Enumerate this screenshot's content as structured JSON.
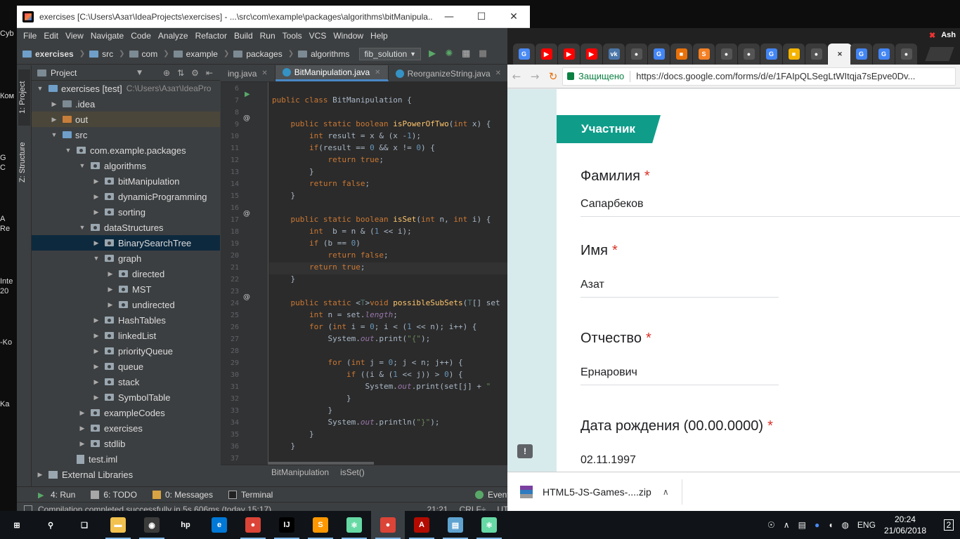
{
  "desktop": {
    "labels": [
      "Cyb",
      "Ком",
      "G",
      "C",
      "A",
      "Re",
      "Inte",
      "20",
      "-Ko",
      "Ka"
    ]
  },
  "idea": {
    "title": "exercises [C:\\Users\\Азат\\IdeaProjects\\exercises] - ...\\src\\com\\example\\packages\\algorithms\\bitManipula...",
    "menu": [
      "File",
      "Edit",
      "View",
      "Navigate",
      "Code",
      "Analyze",
      "Refactor",
      "Build",
      "Run",
      "Tools",
      "VCS",
      "Window",
      "Help"
    ],
    "nav": [
      "exercises",
      "src",
      "com",
      "example",
      "packages",
      "algorithms"
    ],
    "run_config": "fib_solution",
    "tool_strip": [
      "1: Project",
      "Z: Structure"
    ],
    "project_panel": {
      "title": "Project",
      "tree": [
        {
          "label": "exercises [test]",
          "path": "C:\\Users\\Азат\\IdeaPro",
          "depth": 0,
          "arrow": "down",
          "icon": "folder-blue"
        },
        {
          "label": ".idea",
          "depth": 1,
          "arrow": "right",
          "icon": "folder"
        },
        {
          "label": "out",
          "depth": 1,
          "arrow": "right",
          "icon": "folder-orange"
        },
        {
          "label": "src",
          "depth": 1,
          "arrow": "down",
          "icon": "folder-blue"
        },
        {
          "label": "com.example.packages",
          "depth": 2,
          "arrow": "down",
          "icon": "package"
        },
        {
          "label": "algorithms",
          "depth": 3,
          "arrow": "down",
          "icon": "package"
        },
        {
          "label": "bitManipulation",
          "depth": 4,
          "arrow": "right",
          "icon": "package"
        },
        {
          "label": "dynamicProgramming",
          "depth": 4,
          "arrow": "right",
          "icon": "package"
        },
        {
          "label": "sorting",
          "depth": 4,
          "arrow": "right",
          "icon": "package"
        },
        {
          "label": "dataStructures",
          "depth": 3,
          "arrow": "down",
          "icon": "package"
        },
        {
          "label": "BinarySearchTree",
          "depth": 4,
          "arrow": "right",
          "icon": "package"
        },
        {
          "label": "graph",
          "depth": 4,
          "arrow": "down",
          "icon": "package"
        },
        {
          "label": "directed",
          "depth": 5,
          "arrow": "right",
          "icon": "package"
        },
        {
          "label": "MST",
          "depth": 5,
          "arrow": "right",
          "icon": "package"
        },
        {
          "label": "undirected",
          "depth": 5,
          "arrow": "right",
          "icon": "package"
        },
        {
          "label": "HashTables",
          "depth": 4,
          "arrow": "right",
          "icon": "package"
        },
        {
          "label": "linkedList",
          "depth": 4,
          "arrow": "right",
          "icon": "package"
        },
        {
          "label": "priorityQueue",
          "depth": 4,
          "arrow": "right",
          "icon": "package"
        },
        {
          "label": "queue",
          "depth": 4,
          "arrow": "right",
          "icon": "package"
        },
        {
          "label": "stack",
          "depth": 4,
          "arrow": "right",
          "icon": "package"
        },
        {
          "label": "SymbolTable",
          "depth": 4,
          "arrow": "right",
          "icon": "package"
        },
        {
          "label": "exampleCodes",
          "depth": 3,
          "arrow": "right",
          "icon": "package"
        },
        {
          "label": "exercises",
          "depth": 3,
          "arrow": "right",
          "icon": "package"
        },
        {
          "label": "stdlib",
          "depth": 3,
          "arrow": "right",
          "icon": "package"
        },
        {
          "label": "test.iml",
          "depth": 2,
          "arrow": "",
          "icon": "file"
        },
        {
          "label": "External Libraries",
          "depth": 0,
          "arrow": "right",
          "icon": "library"
        }
      ]
    },
    "editor": {
      "tabs": [
        {
          "label": "ing.java",
          "active": false
        },
        {
          "label": "BitManipulation.java",
          "active": true
        },
        {
          "label": "ReorganizeString.java",
          "active": false
        }
      ],
      "line_numbers": [
        "6",
        "7",
        "8",
        "9",
        "10",
        "11",
        "12",
        "13",
        "14",
        "15",
        "16",
        "17",
        "18",
        "19",
        "20",
        "21",
        "22",
        "23",
        "24",
        "25",
        "26",
        "27",
        "28",
        "29",
        "30",
        "31",
        "32",
        "33",
        "34",
        "35",
        "36",
        "37"
      ],
      "lines": [
        "",
        "public class BitManipulation {",
        "",
        "    public static boolean isPowerOfTwo(int x) {",
        "        int result = x & (x -1);",
        "        if(result == 0 && x != 0) {",
        "            return true;",
        "        }",
        "        return false;",
        "    }",
        "",
        "    public static boolean isSet(int n, int i) {",
        "        int  b = n & (1 << i);",
        "        if (b == 0)",
        "            return false;",
        "        return true;",
        "    }",
        "",
        "    public static <T>void possibleSubSets(T[] set",
        "        int n = set.length;",
        "        for (int i = 0; i < (1 << n); i++) {",
        "            System.out.print(\"{\");",
        "",
        "            for (int j = 0; j < n; j++) {",
        "                if ((i & (1 << j)) > 0) {",
        "                    System.out.print(set[j] + \"",
        "                }",
        "            }",
        "            System.out.println(\"}\");",
        "        }",
        "    }",
        ""
      ],
      "breadcrumbs": [
        "BitManipulation",
        "isSet()"
      ]
    },
    "bottom_tools": [
      "4: Run",
      "6: TODO",
      "0: Messages",
      "Terminal",
      "Event Log"
    ],
    "status": {
      "message": "Compilation completed successfully in 5s 606ms (today 15:17)",
      "position": "21:21",
      "line_sep": "CRLF÷",
      "encoding": "UTF-8÷"
    }
  },
  "chrome": {
    "top_right": [
      "✖",
      "Ash"
    ],
    "tabs": [
      {
        "icon": "google-translate",
        "color": "#4a8af4",
        "label": "G"
      },
      {
        "icon": "youtube",
        "color": "#ff0000",
        "label": "▶"
      },
      {
        "icon": "youtube",
        "color": "#ff0000",
        "label": "▶"
      },
      {
        "icon": "youtube",
        "color": "#ff0000",
        "label": "▶"
      },
      {
        "icon": "vk",
        "color": "#4a76a8",
        "label": "vk"
      },
      {
        "icon": "github",
        "color": "#555555",
        "label": "●"
      },
      {
        "icon": "google",
        "color": "#4285f4",
        "label": "G"
      },
      {
        "icon": "document",
        "color": "#e8710a",
        "label": "■"
      },
      {
        "icon": "stackoverflow",
        "color": "#f48024",
        "label": "S"
      },
      {
        "icon": "github",
        "color": "#555555",
        "label": "●"
      },
      {
        "icon": "github",
        "color": "#555555",
        "label": "●"
      },
      {
        "icon": "google",
        "color": "#4285f4",
        "label": "G"
      },
      {
        "icon": "colors",
        "color": "#f4b400",
        "label": "■"
      },
      {
        "icon": "github",
        "color": "#555555",
        "label": "●"
      },
      {
        "icon": "close",
        "color": "#f2f2f2",
        "label": "✕",
        "active": true
      },
      {
        "icon": "google",
        "color": "#4285f4",
        "label": "G"
      },
      {
        "icon": "google",
        "color": "#4285f4",
        "label": "G"
      },
      {
        "icon": "github",
        "color": "#555555",
        "label": "●"
      }
    ],
    "secure_label": "Защищено",
    "url": "https://docs.google.com/forms/d/e/1FAIpQLSegLtWItqja7sEpve0Dv...",
    "form": {
      "section_title": "Участник",
      "questions": [
        {
          "label": "Фамилия",
          "required": "*",
          "answer": "Сапарбеков"
        },
        {
          "label": "Имя",
          "required": "*",
          "answer": "Азат"
        },
        {
          "label": "Отчество",
          "required": "*",
          "answer": "Ернарович"
        },
        {
          "label": "Дата рождения (00.00.0000)",
          "required": "*",
          "answer": "02.11.1997"
        }
      ],
      "feedback_glyph": "!"
    },
    "download": {
      "filename": "HTML5-JS-Games-....zip",
      "chevron": "∧"
    }
  },
  "taskbar": {
    "apps": [
      {
        "name": "start",
        "label": "⊞",
        "color": "#101418"
      },
      {
        "name": "search",
        "label": "⚲",
        "color": "#101418"
      },
      {
        "name": "task-view",
        "label": "❑",
        "color": "#101418"
      },
      {
        "name": "file-explorer",
        "label": "▬",
        "color": "#f2c14e"
      },
      {
        "name": "media",
        "label": "◉",
        "color": "#3b3b3b"
      },
      {
        "name": "hp",
        "label": "hp",
        "color": "#101418"
      },
      {
        "name": "edge",
        "label": "e",
        "color": "#0078d7"
      },
      {
        "name": "chrome",
        "label": "●",
        "color": "#db4437"
      },
      {
        "name": "intellij",
        "label": "IJ",
        "color": "#000000"
      },
      {
        "name": "sublime",
        "label": "S",
        "color": "#ff9800"
      },
      {
        "name": "atom",
        "label": "⚛",
        "color": "#66d9a4"
      },
      {
        "name": "chrome-active",
        "label": "●",
        "color": "#db4437"
      },
      {
        "name": "acrobat",
        "label": "A",
        "color": "#b30b00"
      },
      {
        "name": "notes",
        "label": "▤",
        "color": "#5fa3d0"
      },
      {
        "name": "atom2",
        "label": "⚛",
        "color": "#66d9a4"
      }
    ],
    "tray": [
      "☉",
      "∧",
      "▤",
      "●",
      "◖",
      "◍",
      "ENG"
    ],
    "time": "20:24",
    "date": "21/06/2018",
    "notifications": "2"
  }
}
